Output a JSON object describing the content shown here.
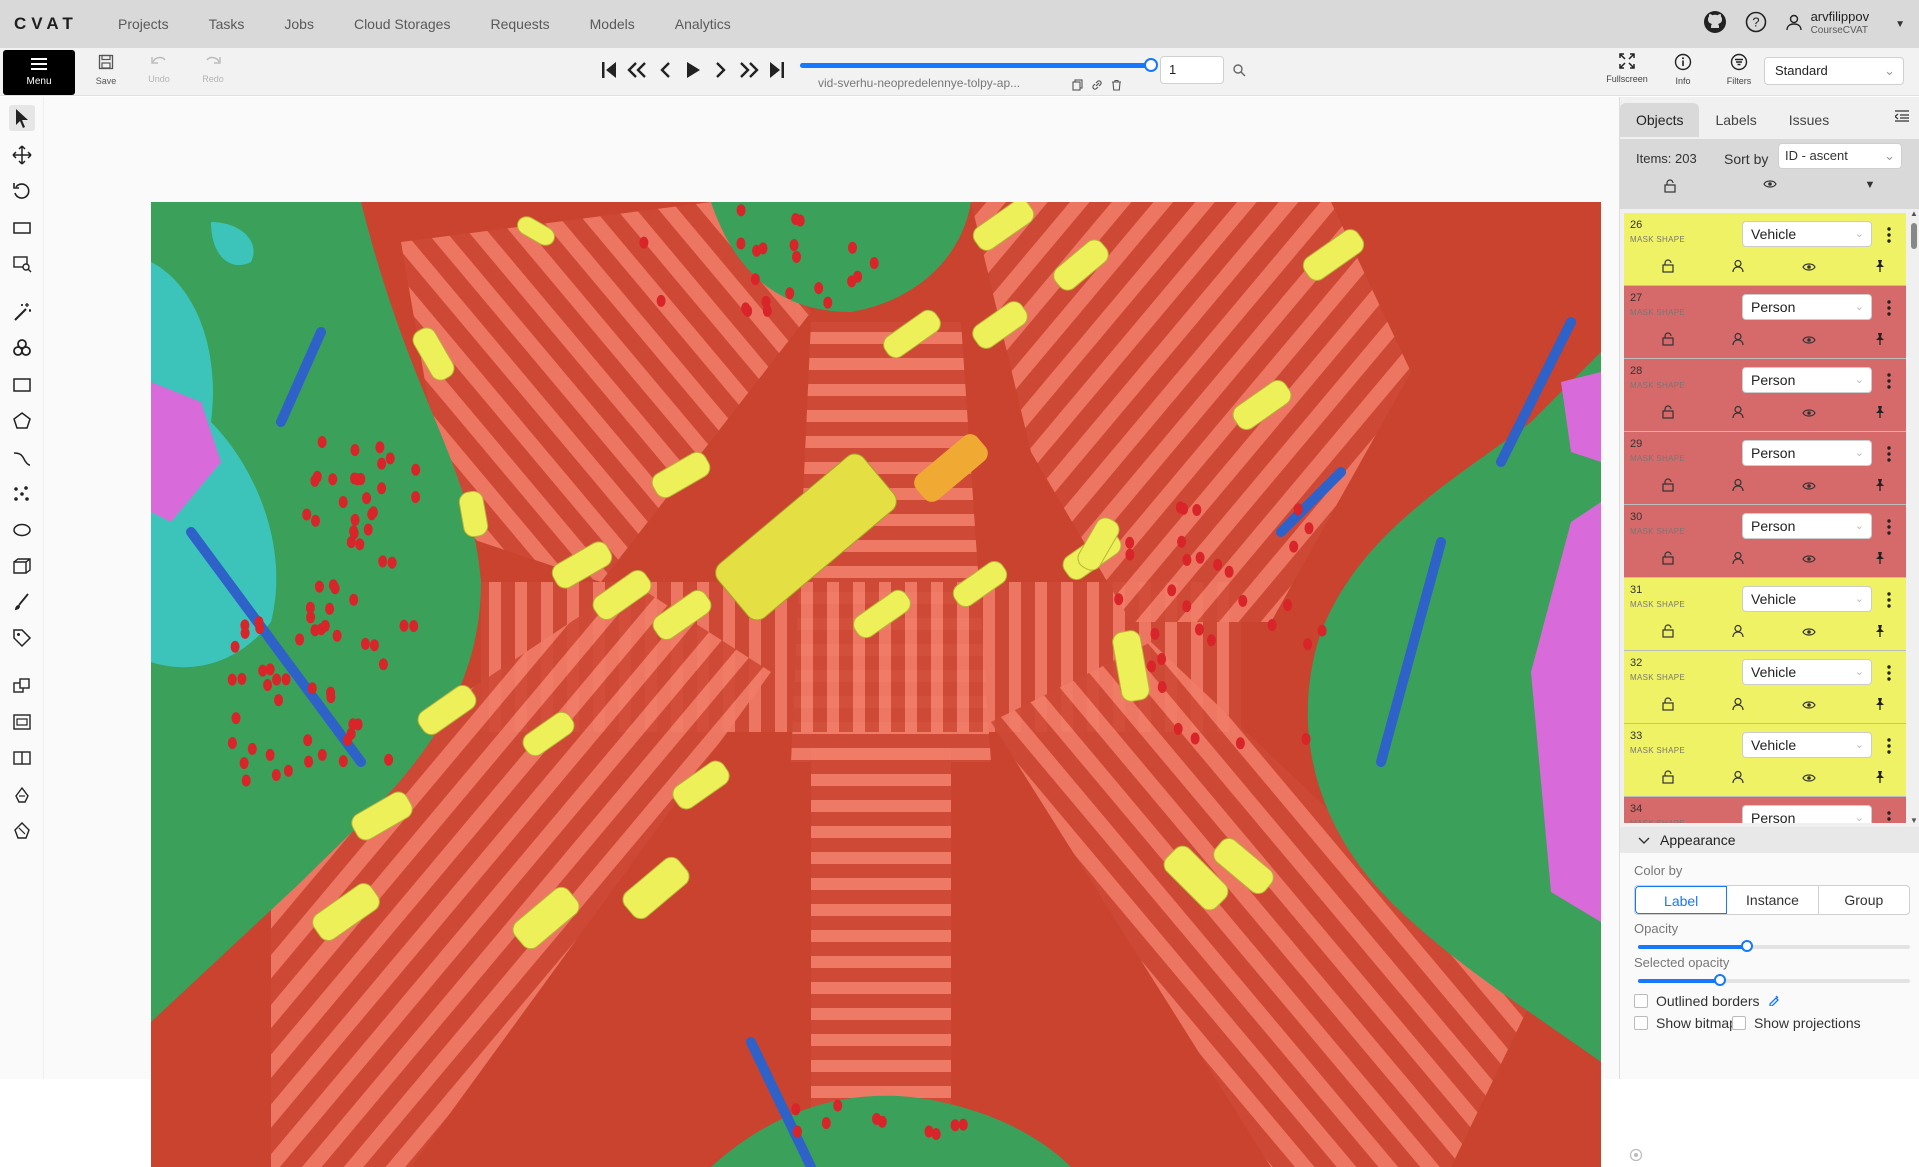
{
  "header": {
    "logo": "CVAT",
    "nav": [
      "Projects",
      "Tasks",
      "Jobs",
      "Cloud Storages",
      "Requests",
      "Models",
      "Analytics"
    ],
    "user": {
      "name": "arvfilippov",
      "org": "CourseCVAT"
    }
  },
  "toolbar": {
    "menu_label": "Menu",
    "save_label": "Save",
    "undo_label": "Undo",
    "redo_label": "Redo",
    "filename": "vid-sverhu-neopredelennye-tolpy-ap...",
    "frame_number": "1",
    "frame_progress": 1.0,
    "fullscreen_label": "Fullscreen",
    "info_label": "Info",
    "filters_label": "Filters",
    "workspace": "Standard"
  },
  "left_tools": [
    "cursor-icon",
    "move-icon",
    "rotate-icon",
    "fit-image-icon",
    "zoom-region-icon",
    "magic-wand-icon",
    "openvino-icon",
    "rectangle-icon",
    "polygon-icon",
    "polyline-icon",
    "points-icon",
    "ellipse-icon",
    "cuboid-icon",
    "brush-icon",
    "tag-icon",
    "merge-icon",
    "group-icon",
    "split-icon",
    "join-icon",
    "slice-icon"
  ],
  "sidebar": {
    "tabs": [
      "Objects",
      "Labels",
      "Issues"
    ],
    "items_count": "Items: 203",
    "sort_label": "Sort by",
    "sort_value": "ID - ascent",
    "objects": [
      {
        "id": "26",
        "type": "MASK SHAPE",
        "label": "Vehicle"
      },
      {
        "id": "27",
        "type": "MASK SHAPE",
        "label": "Person"
      },
      {
        "id": "28",
        "type": "MASK SHAPE",
        "label": "Person"
      },
      {
        "id": "29",
        "type": "MASK SHAPE",
        "label": "Person"
      },
      {
        "id": "30",
        "type": "MASK SHAPE",
        "label": "Person"
      },
      {
        "id": "31",
        "type": "MASK SHAPE",
        "label": "Vehicle"
      },
      {
        "id": "32",
        "type": "MASK SHAPE",
        "label": "Vehicle"
      },
      {
        "id": "33",
        "type": "MASK SHAPE",
        "label": "Vehicle"
      },
      {
        "id": "34",
        "type": "MASK SHAPE",
        "label": "Person"
      }
    ],
    "appearance": {
      "title": "Appearance",
      "color_by_label": "Color by",
      "color_by_options": [
        "Label",
        "Instance",
        "Group"
      ],
      "color_by_selected": "Label",
      "opacity_label": "Opacity",
      "opacity_value": 0.4,
      "selected_opacity_label": "Selected opacity",
      "selected_opacity_value": 0.3,
      "outlined_borders_label": "Outlined borders",
      "show_bitmap_label": "Show bitmap",
      "show_projections_label": "Show projections"
    }
  },
  "colors": {
    "vehicle": "#f0f266",
    "person": "#d66a6a",
    "road": "#c9432f",
    "crosswalk": "#f07060",
    "sidewalk": "#3aa05a",
    "pole": "#2e62c9",
    "tree": "#3cc4bb",
    "building": "#d96ad9",
    "accent": "#1677ff"
  }
}
